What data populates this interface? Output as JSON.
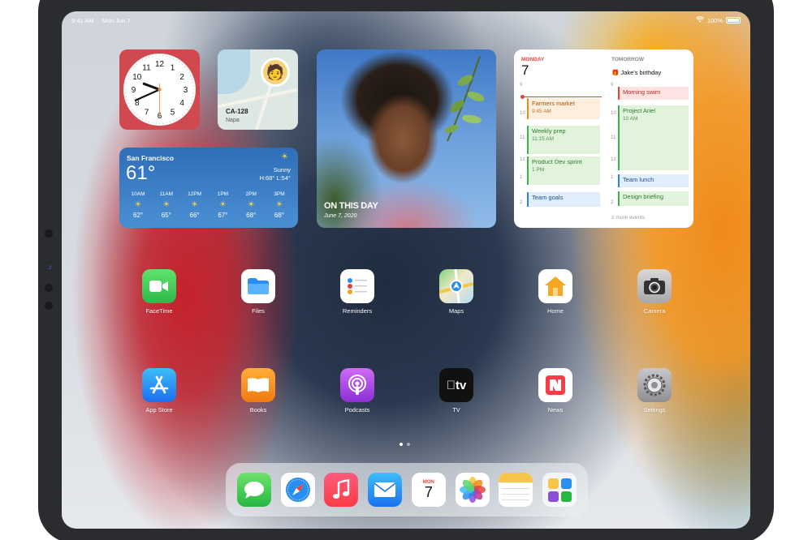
{
  "status_bar": {
    "time": "9:41 AM",
    "date": "Mon Jun 7",
    "wifi_icon": "wifi-icon",
    "battery": "100%"
  },
  "clock_widget": {
    "hour": 9,
    "minute": 41
  },
  "map_widget": {
    "title": "CA-128",
    "subtitle": "Napa"
  },
  "weather_widget": {
    "city": "San Francisco",
    "temp": "61°",
    "condition": "Sunny",
    "hilo": "H:68° L:54°",
    "hours": [
      {
        "time": "10AM",
        "temp": "62°"
      },
      {
        "time": "11AM",
        "temp": "65°"
      },
      {
        "time": "12PM",
        "temp": "66°"
      },
      {
        "time": "1PM",
        "temp": "67°"
      },
      {
        "time": "2PM",
        "temp": "68°"
      },
      {
        "time": "3PM",
        "temp": "68°"
      }
    ]
  },
  "photo_widget": {
    "title": "ON THIS DAY",
    "date": "June 7, 2020"
  },
  "calendar_widget": {
    "today_label": "MONDAY",
    "today_date": "7",
    "tomorrow_label": "TOMORROW",
    "hours_left": [
      "9",
      "10",
      "11",
      "12",
      "1",
      "2"
    ],
    "hours_right": [
      "9",
      "10",
      "11",
      "12",
      "1",
      "2"
    ],
    "today_events": [
      {
        "title": "Farmers market",
        "time": "9:45 AM"
      },
      {
        "title": "Weekly prep",
        "time": "11:15 AM"
      },
      {
        "title": "Product Dev sprint",
        "time": "1 PM"
      },
      {
        "title": "Team goals",
        "time": ""
      }
    ],
    "birthday": "Jake's birthday",
    "tomorrow_events": [
      {
        "title": "Morning swim",
        "time": ""
      },
      {
        "title": "Project Ariel",
        "time": "10 AM"
      },
      {
        "title": "Team lunch",
        "time": ""
      },
      {
        "title": "Design briefing",
        "time": ""
      }
    ],
    "more": "2 more events"
  },
  "apps_row1": [
    {
      "label": "FaceTime",
      "icon": "facetime-icon"
    },
    {
      "label": "Files",
      "icon": "files-icon"
    },
    {
      "label": "Reminders",
      "icon": "reminders-icon"
    },
    {
      "label": "Maps",
      "icon": "maps-icon"
    },
    {
      "label": "Home",
      "icon": "home-icon"
    },
    {
      "label": "Camera",
      "icon": "camera-icon"
    }
  ],
  "apps_row2": [
    {
      "label": "App Store",
      "icon": "app-store-icon"
    },
    {
      "label": "Books",
      "icon": "books-icon"
    },
    {
      "label": "Podcasts",
      "icon": "podcasts-icon"
    },
    {
      "label": "TV",
      "icon": "tv-icon"
    },
    {
      "label": "News",
      "icon": "news-icon"
    },
    {
      "label": "Settings",
      "icon": "settings-icon"
    }
  ],
  "dock": {
    "apps": [
      "messages-icon",
      "safari-icon",
      "music-icon",
      "mail-icon",
      "calendar-icon",
      "photos-icon",
      "notes-icon",
      "app-folder-icon"
    ],
    "calendar_day": "MON",
    "calendar_date": "7"
  },
  "tv_label_glyph": "tv",
  "side_mark": "2"
}
